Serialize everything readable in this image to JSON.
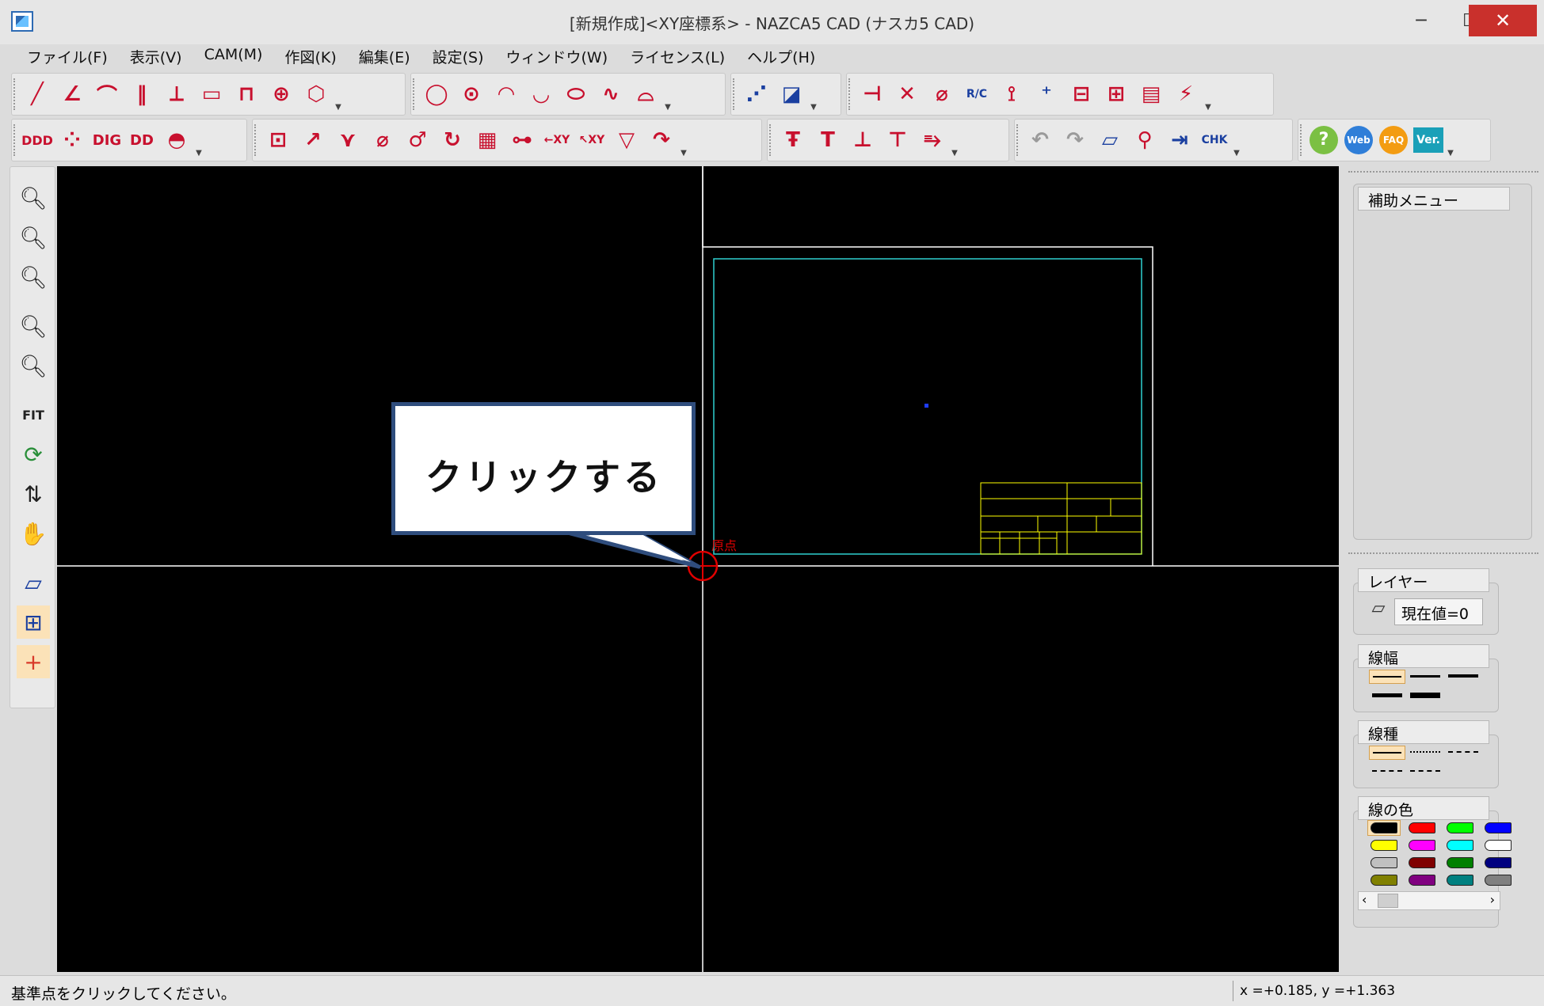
{
  "window": {
    "title": "[新規作成]<XY座標系> - NAZCA5 CAD (ナスカ5 CAD)",
    "minimize_glyph": "─",
    "maximize_glyph": "☐",
    "close_glyph": "✕"
  },
  "menubar": {
    "items": [
      "ファイル(F)",
      "表示(V)",
      "CAM(M)",
      "作図(K)",
      "編集(E)",
      "設定(S)",
      "ウィンドウ(W)",
      "ライセンス(L)",
      "ヘルプ(H)"
    ]
  },
  "callout": {
    "text": "クリックする"
  },
  "canvas": {
    "origin_label": "原点"
  },
  "right_panel": {
    "aux_menu_title": "補助メニュー",
    "layer_title": "レイヤー",
    "layer_current": "現在値=0",
    "line_width_title": "線幅",
    "line_type_title": "線種",
    "line_color_title": "線の色",
    "colors": [
      "#000000",
      "#ff0000",
      "#00ff00",
      "#0000ff",
      "#ffff00",
      "#ff00ff",
      "#00ffff",
      "#ffffff",
      "#c0c0c0",
      "#800000",
      "#008000",
      "#000080",
      "#808000",
      "#800080",
      "#008080",
      "#808080"
    ]
  },
  "statusbar": {
    "message": "基準点をクリックしてください。",
    "coords": "x =+0.185,    y =+1.363"
  },
  "toolbar_icons": {
    "row1_group1": [
      "line-icon",
      "angle-line-icon",
      "tangent-line-icon",
      "parallel-lines-icon",
      "perpendicular-icon",
      "rectangle-icon",
      "polyline-icon",
      "crosshair-circle-icon",
      "hexagon-icon"
    ],
    "row1_group2": [
      "circle-icon",
      "circle-3pt-icon",
      "arc-icon",
      "arc-tangent-icon",
      "ellipse-icon",
      "spline-icon",
      "ellipse-arc-icon"
    ],
    "row1_group4": [
      "extend-icon",
      "cross-trim-icon",
      "break-icon",
      "rc-corner-icon",
      "chamfer-icon",
      "offset-icon",
      "hatch-icon",
      "drawing-frame-icon",
      "print-icon",
      "measure-icon"
    ]
  }
}
